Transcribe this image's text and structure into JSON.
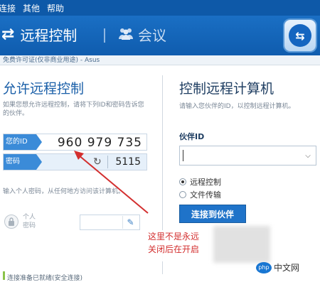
{
  "menu": {
    "items": [
      "连接",
      "其他",
      "帮助"
    ]
  },
  "header": {
    "mode_remote": "远程控制",
    "mode_meeting": "会议"
  },
  "license": {
    "text": "免费许可证(仅非商业用途) - Asus"
  },
  "allow": {
    "title": "允许远程控制",
    "desc": "如果您想允许远程控制，请将下列ID和密码告诉您的伙伴。",
    "id_label": "您的ID",
    "id_value": "960 979 735",
    "pw_label": "密码",
    "pw_value": "5115",
    "personal_desc": "输入个人密码，从任何地方访问该计算机。",
    "personal_label_1": "个人",
    "personal_label_2": "密码",
    "status": "连接准备已就绪(安全连接)"
  },
  "control": {
    "title": "控制远程计算机",
    "desc": "请输入您伙伴的ID，以控制远程计算机。",
    "partner_label": "伙伴ID",
    "partner_value": "",
    "radio_remote": "远程控制",
    "radio_file": "文件传输",
    "connect_button": "连接到伙伴"
  },
  "annotation": {
    "line1": "这里不是永远",
    "line2": "关闭后在开启"
  },
  "watermark": {
    "badge": "php",
    "text": "中文网"
  },
  "colors": {
    "header_blue": "#0e59a8",
    "accent_blue": "#3b8bd8",
    "annotation_red": "#d32f2f"
  }
}
